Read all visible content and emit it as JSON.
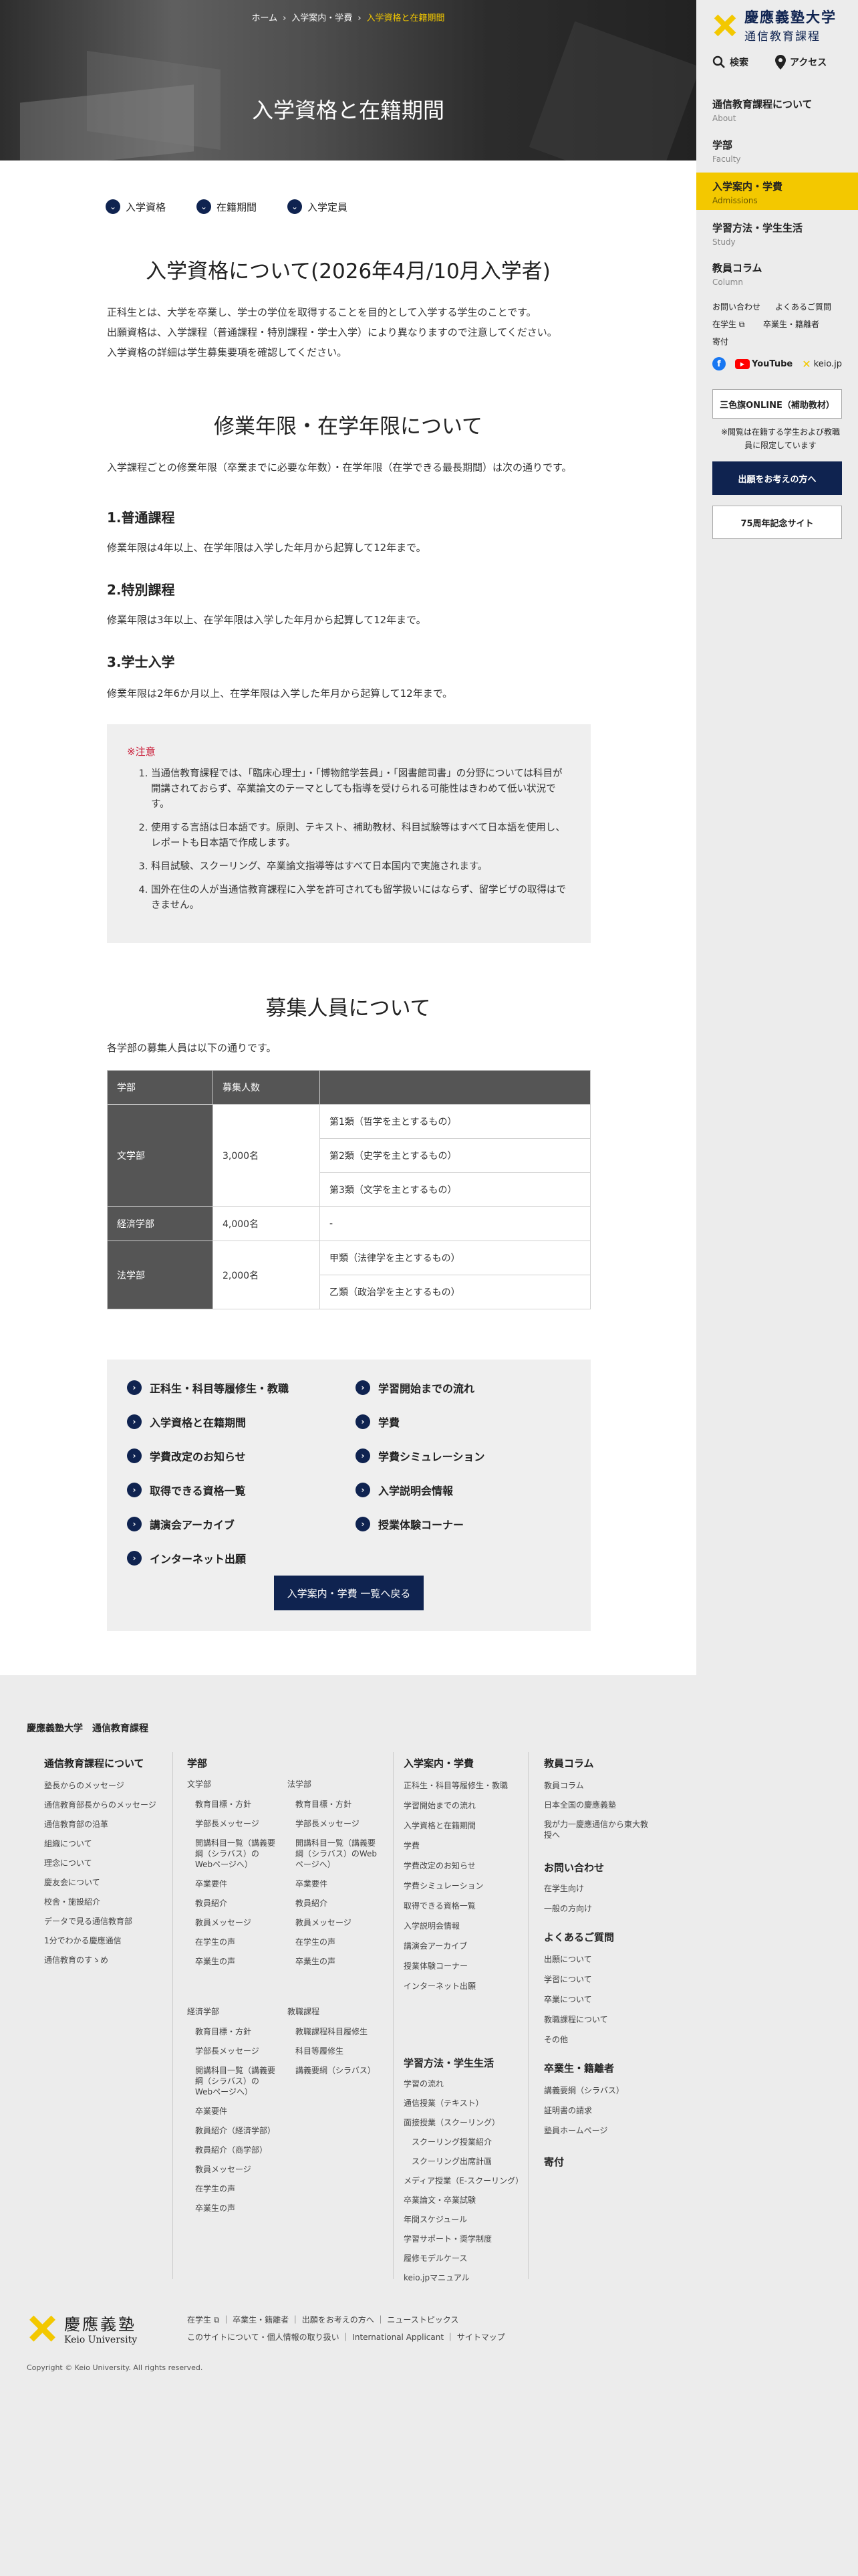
{
  "breadcrumb": {
    "home": "ホーム",
    "sep": "›",
    "parent": "入学案内・学費",
    "current": "入学資格と在籍期間"
  },
  "hero": {
    "title": "入学資格と在籍期間"
  },
  "anchors": [
    "入学資格",
    "在籍期間",
    "入学定員"
  ],
  "section1": {
    "title": "入学資格について(2026年4月/10月入学者)",
    "lines": [
      "正科生とは、大学を卒業し、学士の学位を取得することを目的として入学する学生のことです。",
      "出願資格は、入学課程（普通課程・特別課程・学士入学）により異なりますので注意してください。",
      "入学資格の詳細は学生募集要項を確認してください。"
    ]
  },
  "section2": {
    "title": "修業年限・在学年限について",
    "intro": "入学課程ごとの修業年限（卒業までに必要な年数）・在学年限（在学できる最長期間）は次の通りです。",
    "courses": [
      {
        "name": "1.普通課程",
        "text": "修業年限は4年以上、在学年限は入学した年月から起算して12年まで。"
      },
      {
        "name": "2.特別課程",
        "text": "修業年限は3年以上、在学年限は入学した年月から起算して12年まで。"
      },
      {
        "name": "3.学士入学",
        "text": "修業年限は2年6か月以上、在学年限は入学した年月から起算して12年まで。"
      }
    ]
  },
  "note": {
    "title": "※注意",
    "items": [
      "当通信教育課程では、「臨床心理士」・「博物館学芸員」・「図書館司書」の分野については科目が開講されておらず、卒業論文のテーマとしても指導を受けられる可能性はきわめて低い状況です。",
      "使用する言語は日本語です。原則、テキスト、補助教材、科目試験等はすべて日本語を使用し、レポートも日本語で作成します。",
      "科目試験、スクーリング、卒業論文指導等はすべて日本国内で実施されます。",
      "国外在住の人が当通信教育課程に入学を許可されても留学扱いにはならず、留学ビザの取得はできません。"
    ]
  },
  "section3": {
    "title": "募集人員について",
    "intro": "各学部の募集人員は以下の通りです。",
    "headers": [
      "学部",
      "募集人数",
      ""
    ],
    "rows": [
      {
        "faculty": "文学部",
        "count": "3,000名",
        "subs": [
          "第1類（哲学を主とするもの）",
          "第2類（史学を主とするもの）",
          "第3類（文学を主とするもの）"
        ]
      },
      {
        "faculty": "経済学部",
        "count": "4,000名",
        "subs": [
          "-"
        ]
      },
      {
        "faculty": "法学部",
        "count": "2,000名",
        "subs": [
          "甲類（法律学を主とするもの）",
          "乙類（政治学を主とするもの）"
        ]
      }
    ]
  },
  "linkbox": {
    "items": [
      "正科生・科目等履修生・教職",
      "学習開始までの流れ",
      "入学資格と在籍期間",
      "学費",
      "学費改定のお知らせ",
      "学費シミュレーション",
      "取得できる資格一覧",
      "入学説明会情報",
      "講演会アーカイブ",
      "授業体験コーナー",
      "インターネット出願"
    ],
    "back": "入学案内・学費 一覧へ戻る"
  },
  "sidebar": {
    "logo_line1": "慶應義塾大学",
    "logo_line2": "通信教育課程",
    "search": "検索",
    "access": "アクセス",
    "nav": [
      {
        "jp": "通信教育課程について",
        "en": "About"
      },
      {
        "jp": "学部",
        "en": "Faculty"
      },
      {
        "jp": "入学案内・学費",
        "en": "Admissions"
      },
      {
        "jp": "学習方法・学生生活",
        "en": "Study"
      },
      {
        "jp": "教員コラム",
        "en": "Column"
      }
    ],
    "small_links": [
      "お問い合わせ",
      "よくあるご質問",
      "在学生",
      "卒業生・籍離者",
      "寄付"
    ],
    "social": {
      "youtube": "YouTube",
      "keio": "keio.jp"
    },
    "btn_sanshoku": "三色旗ONLINE（補助教材）",
    "sanshoku_note": "※閲覧は在籍する学生および教職員に限定しています",
    "btn_apply": "出願をお考えの方へ",
    "btn_75": "75周年記念サイト",
    "colors": {
      "navy": "#0f2350",
      "yellow": "#f3c800"
    }
  },
  "footer": {
    "brand": "慶應義塾大学　通信教育課程",
    "about": {
      "title": "通信教育課程について",
      "items": [
        "塾長からのメッセージ",
        "通信教育部長からのメッセージ",
        "通信教育部の沿革",
        "組織について",
        "理念について",
        "慶友会について",
        "校舎・施設紹介",
        "データで見る通信教育部",
        "1分でわかる慶應通信",
        "通信教育のすゝめ"
      ]
    },
    "faculty": {
      "title": "学部",
      "bun": {
        "title": "文学部",
        "items": [
          "教育目標・方針",
          "学部長メッセージ",
          "開講科目一覧（講義要綱（シラバス）のWebページへ）",
          "卒業要件",
          "教員紹介",
          "教員メッセージ",
          "在学生の声",
          "卒業生の声"
        ]
      },
      "hou": {
        "title": "法学部",
        "items": [
          "教育目標・方針",
          "学部長メッセージ",
          "開講科目一覧（講義要綱（シラバス）のWebページへ）",
          "卒業要件",
          "教員紹介",
          "教員メッセージ",
          "在学生の声",
          "卒業生の声"
        ]
      },
      "kei": {
        "title": "経済学部",
        "items": [
          "教育目標・方針",
          "学部長メッセージ",
          "開講科目一覧（講義要綱（シラバス）のWebページへ）",
          "卒業要件",
          "教員紹介（経済学部）",
          "教員紹介（商学部）",
          "教員メッセージ",
          "在学生の声",
          "卒業生の声"
        ]
      },
      "kyoshoku": {
        "title": "教職課程",
        "items": [
          "教職課程科目履修生",
          "科目等履修生",
          "講義要綱（シラバス）"
        ]
      }
    },
    "admission": {
      "title": "入学案内・学費",
      "items": [
        "正科生・科目等履修生・教職",
        "学習開始までの流れ",
        "入学資格と在籍期間",
        "学費",
        "学費改定のお知らせ",
        "学費シミュレーション",
        "取得できる資格一覧",
        "入学説明会情報",
        "講演会アーカイブ",
        "授業体験コーナー",
        "インターネット出願"
      ]
    },
    "study": {
      "title": "学習方法・学生生活",
      "items": [
        "学習の流れ",
        "通信授業（テキスト）",
        "面接授業（スクーリング）",
        "スクーリング授業紹介",
        "スクーリング出席計画",
        "メディア授業（E-スクーリング）",
        "卒業論文・卒業試験",
        "年間スケジュール",
        "学習サポート・奨学制度",
        "履修モデルケース",
        "keio.jpマニュアル"
      ]
    },
    "column": {
      "title": "教員コラム",
      "items": [
        "教員コラム",
        "日本全国の慶應義塾",
        "我が力一慶應通信から東大教授へ"
      ]
    },
    "contact": {
      "title": "お問い合わせ",
      "items": [
        "在学生向け",
        "一般の方向け"
      ]
    },
    "faq": {
      "title": "よくあるご質問",
      "items": [
        "出願について",
        "学習について",
        "卒業について",
        "教職課程について",
        "その他"
      ]
    },
    "alumni": {
      "title": "卒業生・籍離者",
      "items": [
        "講義要綱（シラバス）",
        "証明書の請求",
        "塾員ホームページ"
      ]
    },
    "donate": {
      "title": "寄付"
    },
    "bottom_logo_jp": "慶應義塾",
    "bottom_logo_en": "Keio University",
    "links_row1": [
      "在学生",
      "卒業生・籍離者",
      "出願をお考えの方へ",
      "ニューストピックス"
    ],
    "links_row2": [
      "このサイトについて・個人情報の取り扱い",
      "International Applicant",
      "サイトマップ"
    ],
    "copyright": "Copyright © Keio University. All rights reserved."
  }
}
